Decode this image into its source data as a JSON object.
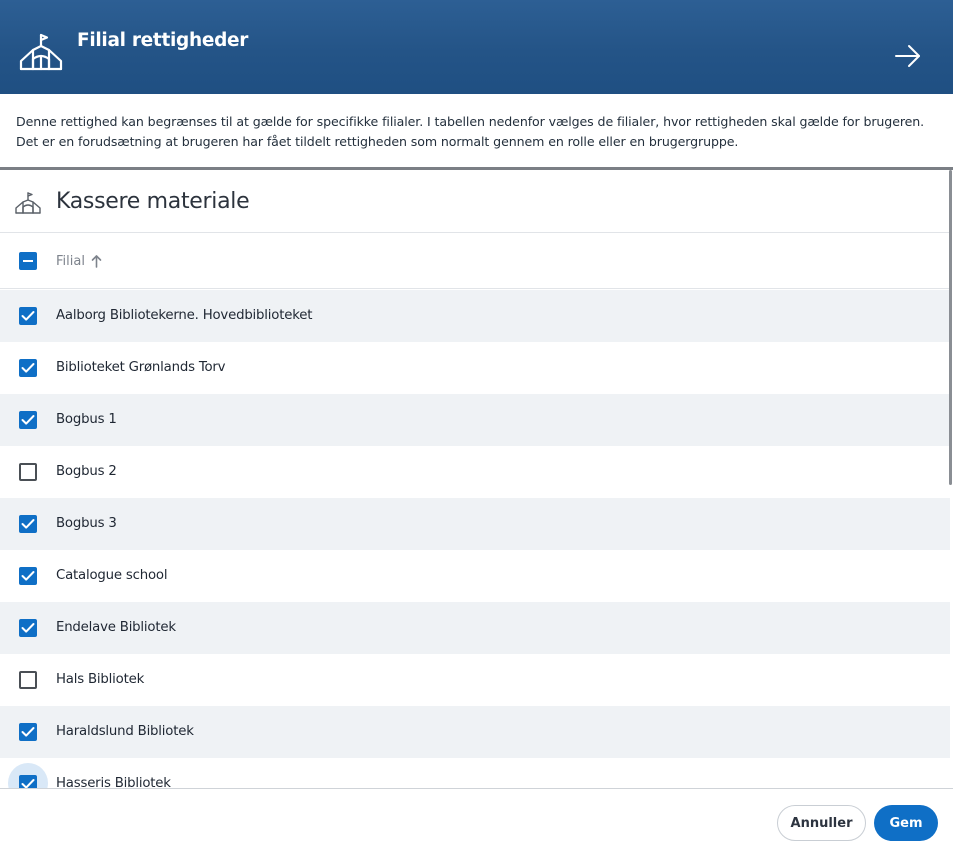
{
  "header": {
    "title": "Filial rettigheder",
    "icon": "library-building-icon",
    "next_icon": "arrow-right-icon"
  },
  "info": {
    "text_line1": "Denne rettighed kan begrænses til at gælde for specifikke filialer. I tabellen nedenfor vælges de filialer, hvor rettigheden skal gælde for brugeren.",
    "text_line2": "Det er en forudsætning at brugeren har fået tildelt rettigheden som normalt gennem en rolle eller en brugergruppe."
  },
  "section": {
    "title": "Kassere materiale",
    "icon": "library-building-icon"
  },
  "table": {
    "select_all_state": "indeterminate",
    "column_label": "Filial",
    "sort_icon": "arrow-up-icon",
    "rows": [
      {
        "label": "Aalborg Bibliotekerne. Hovedbiblioteket",
        "checked": true
      },
      {
        "label": "Biblioteket Grønlands Torv",
        "checked": true
      },
      {
        "label": "Bogbus 1",
        "checked": true
      },
      {
        "label": "Bogbus 2",
        "checked": false
      },
      {
        "label": "Bogbus 3",
        "checked": true
      },
      {
        "label": "Catalogue school",
        "checked": true
      },
      {
        "label": "Endelave Bibliotek",
        "checked": true
      },
      {
        "label": "Hals Bibliotek",
        "checked": false
      },
      {
        "label": "Haraldslund Bibliotek",
        "checked": true
      },
      {
        "label": "Hasseris Bibliotek",
        "checked": true
      }
    ]
  },
  "footer": {
    "cancel_label": "Annuller",
    "save_label": "Gem"
  },
  "colors": {
    "header_bg": "#245487",
    "accent": "#0f6fc6",
    "row_alt": "#eff2f5"
  }
}
